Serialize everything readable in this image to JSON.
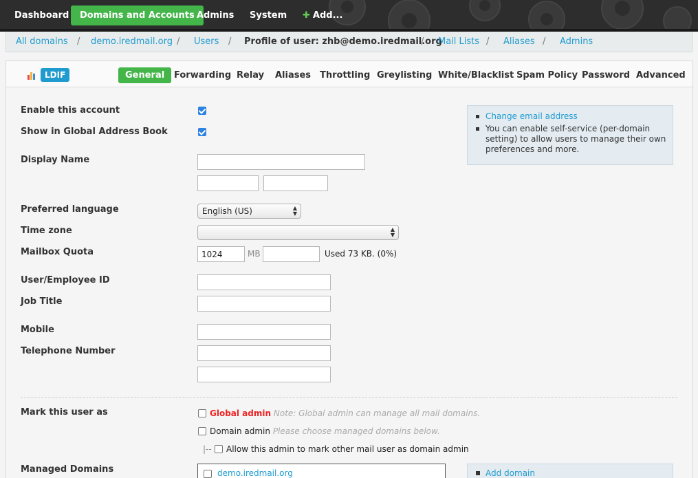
{
  "topnav": {
    "items": [
      {
        "label": "Dashboard"
      },
      {
        "label": "Domains and Accounts"
      },
      {
        "label": "Admins"
      },
      {
        "label": "System"
      },
      {
        "label": "Add..."
      }
    ],
    "active": "Domains and Accounts",
    "plus_glyph": "✚"
  },
  "breadcrumb": {
    "all_domains": "All domains",
    "domain": "demo.iredmail.org",
    "users": "Users",
    "profile": "Profile of user: zhb@demo.iredmail.org",
    "mail_lists": "Mail Lists",
    "aliases": "Aliases",
    "admins": "Admins",
    "separator": "/"
  },
  "tabs": {
    "ldif": "LDIF",
    "items": [
      "General",
      "Forwarding",
      "Relay",
      "Aliases",
      "Throttling",
      "Greylisting",
      "White/Blacklist",
      "Spam Policy",
      "Password",
      "Advanced"
    ],
    "active": "General"
  },
  "form": {
    "enable_account": {
      "label": "Enable this account",
      "checked": true
    },
    "show_gab": {
      "label": "Show in Global Address Book",
      "checked": true
    },
    "display_name": {
      "label": "Display Name",
      "value": "",
      "first_name": "",
      "last_name": ""
    },
    "language": {
      "label": "Preferred language",
      "value": "English (US)"
    },
    "timezone": {
      "label": "Time zone",
      "value": ""
    },
    "quota": {
      "label": "Mailbox Quota",
      "value": "1024",
      "unit": "MB",
      "extra": "",
      "used": "Used 73 KB. (0%)"
    },
    "employee_id": {
      "label": "User/Employee ID",
      "value": ""
    },
    "job_title": {
      "label": "Job Title",
      "value": ""
    },
    "mobile": {
      "label": "Mobile",
      "value": ""
    },
    "telephone": {
      "label": "Telephone Number",
      "value": "",
      "value2": ""
    },
    "mark_as": {
      "label": "Mark this user as",
      "global_admin": "Global admin",
      "global_admin_note": "Note: Global admin can manage all mail domains.",
      "domain_admin": "Domain admin",
      "domain_admin_note": "Please choose managed domains below.",
      "allow_mark_prefix": "|--",
      "allow_mark": "Allow this admin to mark other mail user as domain admin"
    },
    "managed_domains": {
      "label": "Managed Domains",
      "items": [
        "demo.iredmail.org"
      ]
    }
  },
  "info": {
    "change_email": "Change email address",
    "self_service": "You can enable self-service (per-domain setting) to allow users to manage their own preferences and more.",
    "add_domain": "Add domain"
  },
  "colors": {
    "accent_green": "#43b549",
    "link_blue": "#1f9bd0",
    "checkbox_blue": "#2f82e0",
    "nav_bg": "#2d2d2d"
  }
}
